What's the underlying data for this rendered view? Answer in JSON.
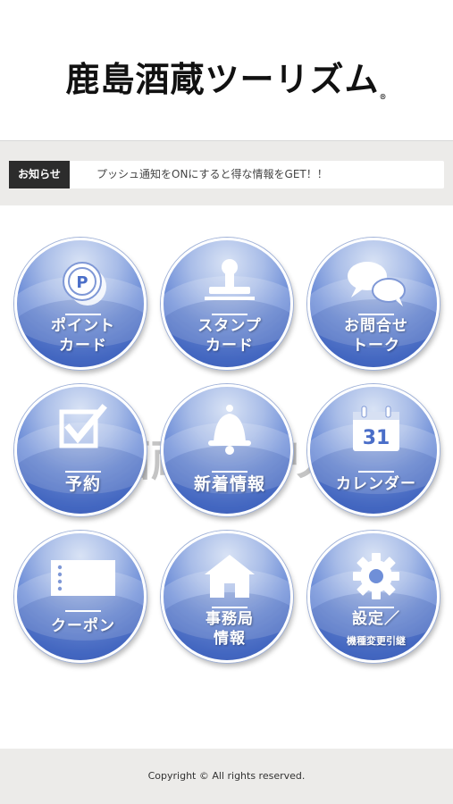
{
  "header": {
    "logo_text": "鹿島酒蔵ツーリズム",
    "logo_mark": "®"
  },
  "notice": {
    "label": "お知らせ",
    "text": "プッシュ通知をONにすると得な情報をGET！！"
  },
  "watermark": {
    "text": "鹿島酒蔵ツーリズム",
    "mark": "®"
  },
  "menu": {
    "point_card": {
      "line1": "ポイント",
      "line2": "カード",
      "icon": "coin-p-icon",
      "icon_text": "P"
    },
    "stamp_card": {
      "line1": "スタンプ",
      "line2": "カード",
      "icon": "stamp-icon"
    },
    "talk": {
      "line1": "お問合せ",
      "line2": "トーク",
      "icon": "chat-bubbles-icon"
    },
    "reserve": {
      "line1": "予約",
      "icon": "checkbox-icon"
    },
    "news": {
      "line1": "新着情報",
      "icon": "bell-icon"
    },
    "calendar": {
      "line1": "カレンダー",
      "icon": "calendar-icon",
      "icon_text": "31"
    },
    "coupon": {
      "line1": "クーポン",
      "icon": "ticket-icon"
    },
    "office": {
      "line1": "事務局",
      "line2": "情報",
      "icon": "house-icon"
    },
    "settings": {
      "line1": "設定／",
      "line2": "機種変更引継",
      "icon": "gear-icon"
    }
  },
  "footer": {
    "copyright": "Copyright © All rights reserved."
  },
  "colors": {
    "button_blue": "#4a6ec8",
    "notice_label_bg": "#2c2c2c",
    "band_bg": "#ecebe9"
  }
}
